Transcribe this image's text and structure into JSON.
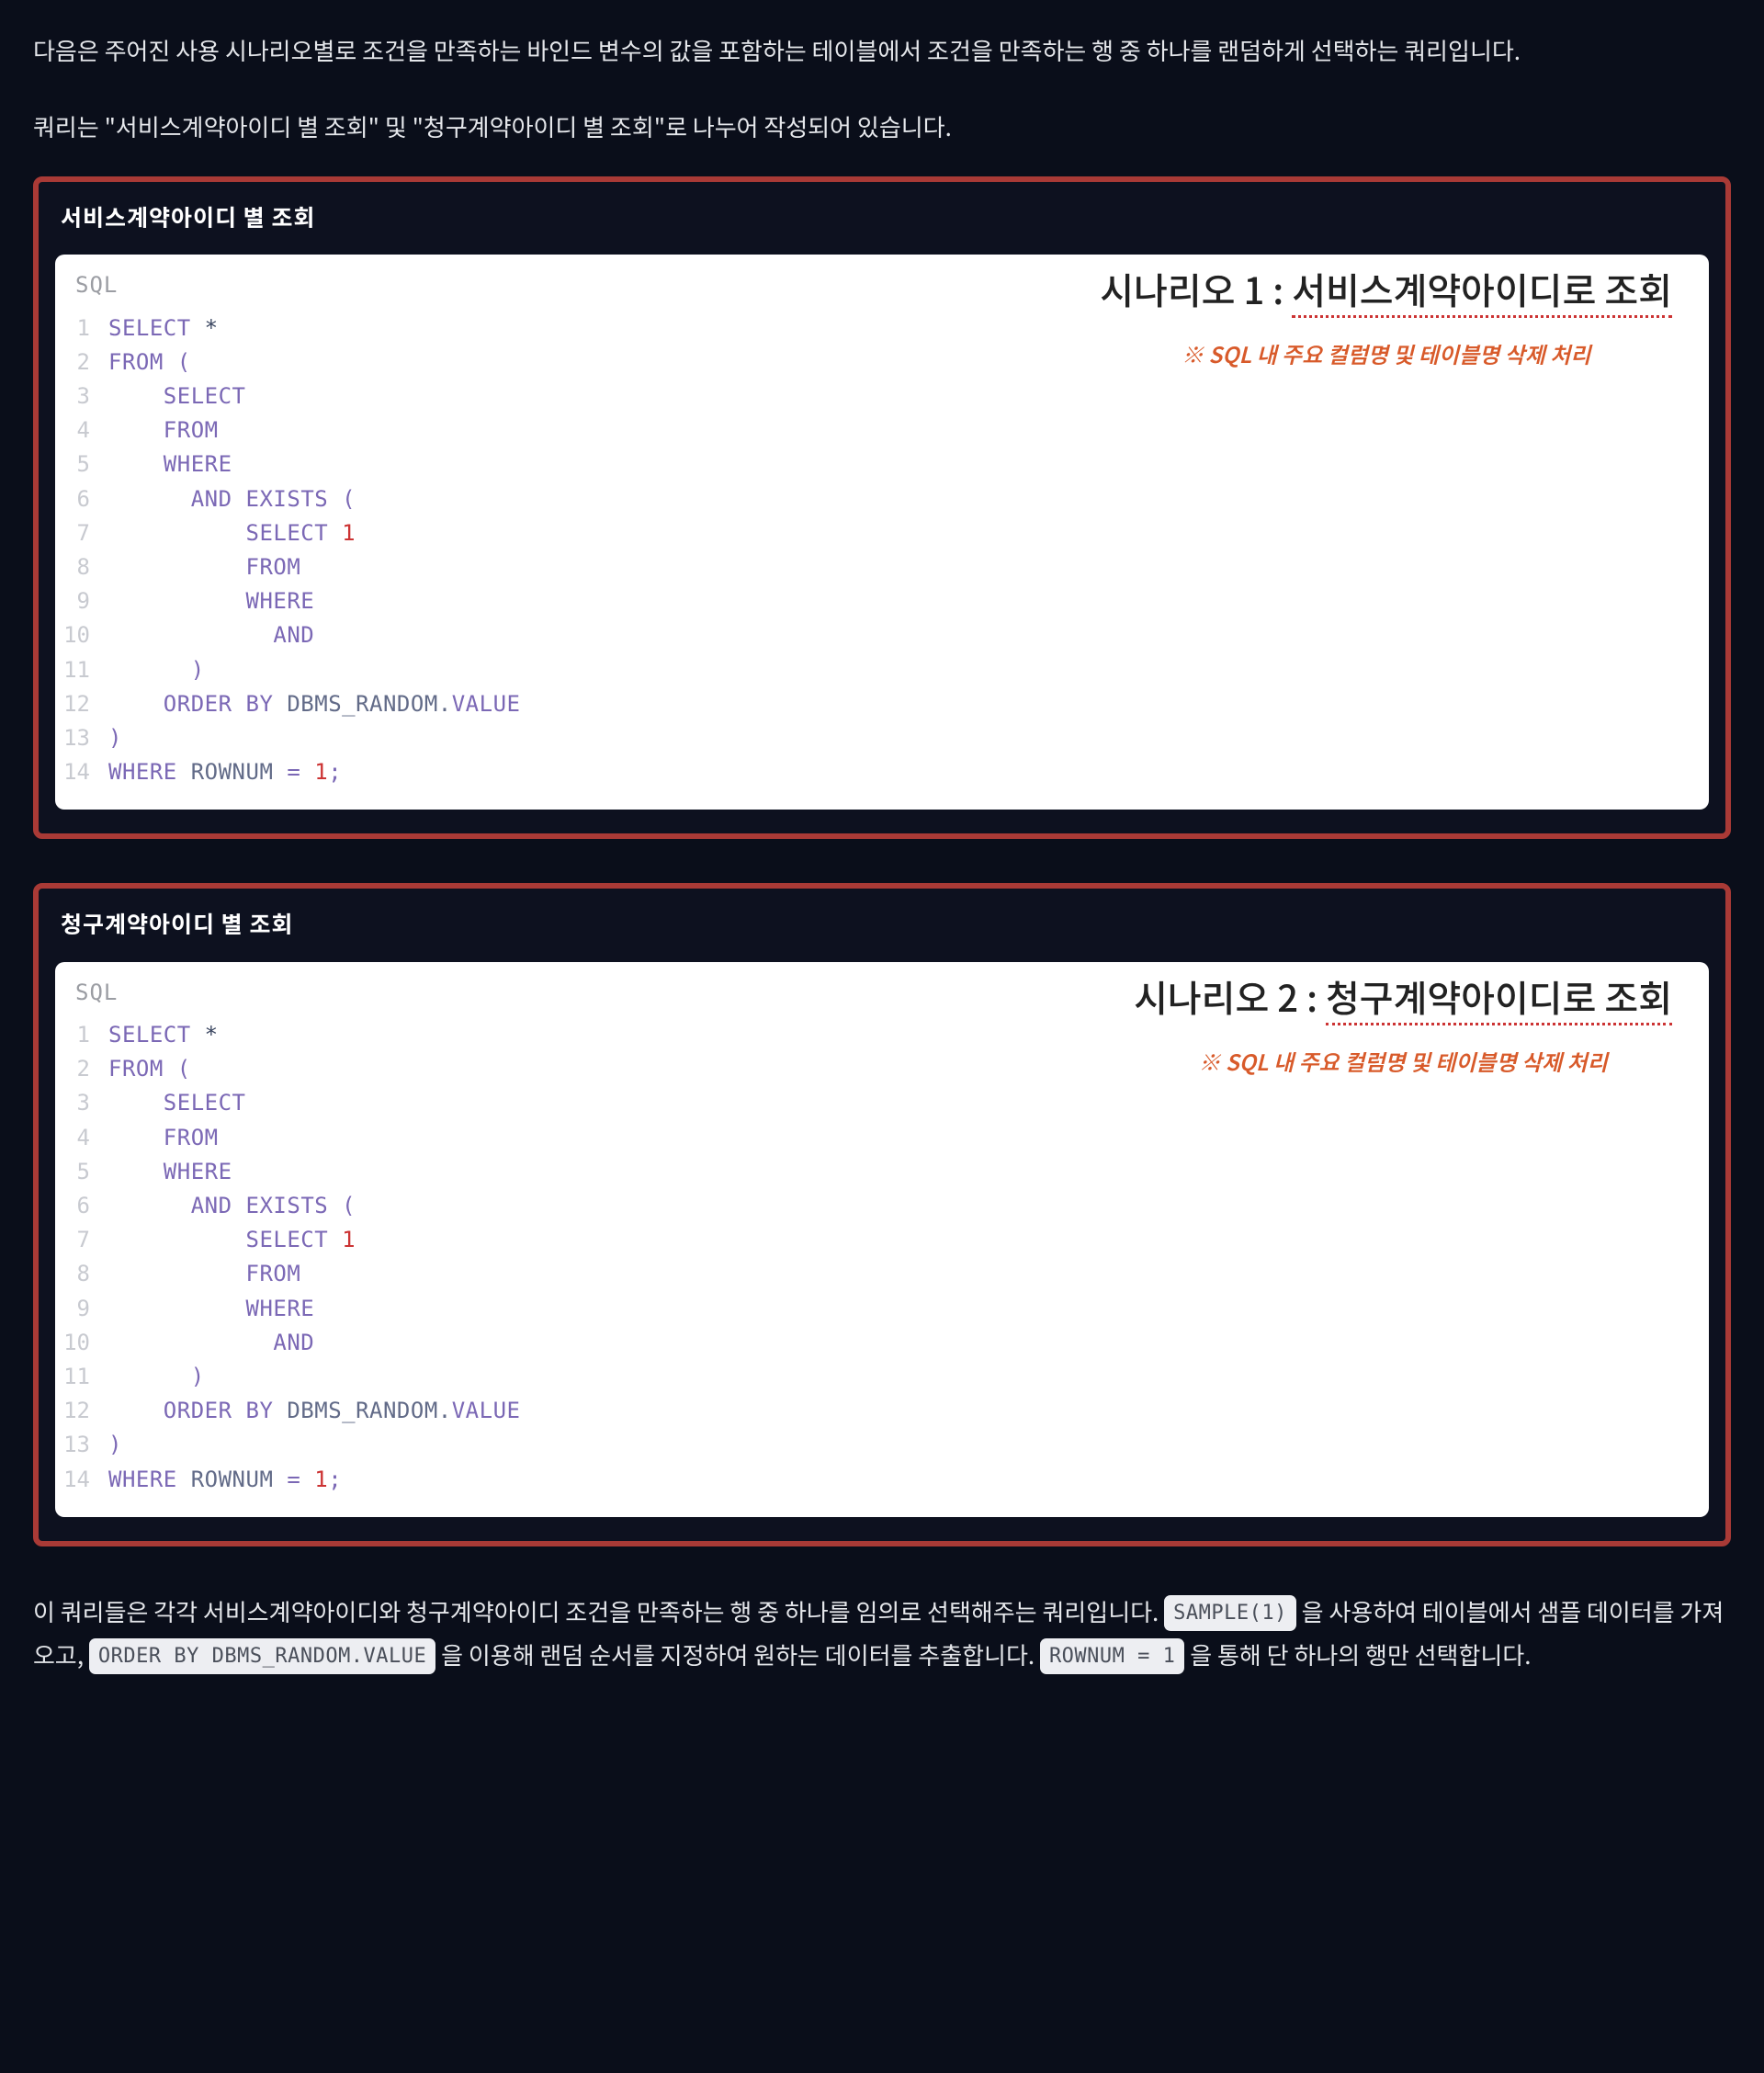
{
  "intro1": "다음은 주어진 사용 시나리오별로 조건을 만족하는 바인드 변수의 값을 포함하는 테이블에서 조건을 만족하는 행 중 하나를 랜덤하게 선택하는 쿼리입니다.",
  "intro2": "쿼리는 \"서비스계약아이디 별 조회\" 및 \"청구계약아이디 별 조회\"로 나누어 작성되어 있습니다.",
  "sections": [
    {
      "title": "서비스계약아이디 별 조회",
      "lang": "SQL",
      "scenario_label_prefix": "시나리오 1 : ",
      "scenario_label_main": "서비스계약아이디로 조회",
      "redaction_note": "※ SQL 내 주요 컬럼명 및 테이블명 삭제 처리",
      "lines": [
        [
          {
            "t": "SELECT",
            "c": "kw"
          },
          {
            "t": " *",
            "c": ""
          }
        ],
        [
          {
            "t": "FROM",
            "c": "kw"
          },
          {
            "t": " (",
            "c": "sym"
          }
        ],
        [
          {
            "t": "    ",
            "c": ""
          },
          {
            "t": "SELECT",
            "c": "kw"
          }
        ],
        [
          {
            "t": "    ",
            "c": ""
          },
          {
            "t": "FROM",
            "c": "kw"
          }
        ],
        [
          {
            "t": "    ",
            "c": ""
          },
          {
            "t": "WHERE",
            "c": "kw"
          }
        ],
        [
          {
            "t": "      ",
            "c": ""
          },
          {
            "t": "AND",
            "c": "kw"
          },
          {
            "t": " ",
            "c": ""
          },
          {
            "t": "EXISTS",
            "c": "kw"
          },
          {
            "t": " (",
            "c": "sym"
          }
        ],
        [
          {
            "t": "          ",
            "c": ""
          },
          {
            "t": "SELECT",
            "c": "kw"
          },
          {
            "t": " ",
            "c": ""
          },
          {
            "t": "1",
            "c": "num"
          }
        ],
        [
          {
            "t": "          ",
            "c": ""
          },
          {
            "t": "FROM",
            "c": "kw"
          }
        ],
        [
          {
            "t": "          ",
            "c": ""
          },
          {
            "t": "WHERE",
            "c": "kw"
          }
        ],
        [
          {
            "t": "            ",
            "c": ""
          },
          {
            "t": "AND",
            "c": "kw"
          }
        ],
        [
          {
            "t": "      ",
            "c": ""
          },
          {
            "t": ")",
            "c": "sym"
          }
        ],
        [
          {
            "t": "    ",
            "c": ""
          },
          {
            "t": "ORDER BY",
            "c": "kw"
          },
          {
            "t": " DBMS_RANDOM.",
            "c": "id"
          },
          {
            "t": "VALUE",
            "c": "kw"
          }
        ],
        [
          {
            "t": ")",
            "c": "sym"
          }
        ],
        [
          {
            "t": "WHERE",
            "c": "kw"
          },
          {
            "t": " ROWNUM ",
            "c": "id"
          },
          {
            "t": "=",
            "c": "sym"
          },
          {
            "t": " ",
            "c": ""
          },
          {
            "t": "1",
            "c": "num"
          },
          {
            "t": ";",
            "c": "sym"
          }
        ]
      ]
    },
    {
      "title": "청구계약아이디 별 조회",
      "lang": "SQL",
      "scenario_label_prefix": "시나리오 2 : ",
      "scenario_label_main": "청구계약아이디로 조회",
      "redaction_note": "※ SQL 내 주요 컬럼명 및 테이블명 삭제 처리",
      "lines": [
        [
          {
            "t": "SELECT",
            "c": "kw"
          },
          {
            "t": " *",
            "c": ""
          }
        ],
        [
          {
            "t": "FROM",
            "c": "kw"
          },
          {
            "t": " (",
            "c": "sym"
          }
        ],
        [
          {
            "t": "    ",
            "c": ""
          },
          {
            "t": "SELECT",
            "c": "kw"
          }
        ],
        [
          {
            "t": "    ",
            "c": ""
          },
          {
            "t": "FROM",
            "c": "kw"
          }
        ],
        [
          {
            "t": "    ",
            "c": ""
          },
          {
            "t": "WHERE",
            "c": "kw"
          }
        ],
        [
          {
            "t": "      ",
            "c": ""
          },
          {
            "t": "AND",
            "c": "kw"
          },
          {
            "t": " ",
            "c": ""
          },
          {
            "t": "EXISTS",
            "c": "kw"
          },
          {
            "t": " (",
            "c": "sym"
          }
        ],
        [
          {
            "t": "          ",
            "c": ""
          },
          {
            "t": "SELECT",
            "c": "kw"
          },
          {
            "t": " ",
            "c": ""
          },
          {
            "t": "1",
            "c": "num"
          }
        ],
        [
          {
            "t": "          ",
            "c": ""
          },
          {
            "t": "FROM",
            "c": "kw"
          }
        ],
        [
          {
            "t": "          ",
            "c": ""
          },
          {
            "t": "WHERE",
            "c": "kw"
          }
        ],
        [
          {
            "t": "            ",
            "c": ""
          },
          {
            "t": "AND",
            "c": "kw"
          }
        ],
        [
          {
            "t": "      ",
            "c": ""
          },
          {
            "t": ")",
            "c": "sym"
          }
        ],
        [
          {
            "t": "    ",
            "c": ""
          },
          {
            "t": "ORDER BY",
            "c": "kw"
          },
          {
            "t": " DBMS_RANDOM.",
            "c": "id"
          },
          {
            "t": "VALUE",
            "c": "kw"
          }
        ],
        [
          {
            "t": ")",
            "c": "sym"
          }
        ],
        [
          {
            "t": "WHERE",
            "c": "kw"
          },
          {
            "t": " ROWNUM ",
            "c": "id"
          },
          {
            "t": "=",
            "c": "sym"
          },
          {
            "t": " ",
            "c": ""
          },
          {
            "t": "1",
            "c": "num"
          },
          {
            "t": ";",
            "c": "sym"
          }
        ]
      ]
    }
  ],
  "footer": {
    "seg1": "이 쿼리들은 각각 서비스계약아이디와 청구계약아이디 조건을 만족하는 행 중 하나를 임의로 선택해주는 쿼리입니다. ",
    "pill1": "SAMPLE(1)",
    "seg2": " 을 사용하여 테이블에서 샘플 데이터를 가져오고, ",
    "pill2": "ORDER BY DBMS_RANDOM.VALUE",
    "seg3": " 을 이용해 랜덤 순서를 지정하여 원하는 데이터를 추출합니다. ",
    "pill3": "ROWNUM = 1",
    "seg4": " 을 통해 단 하나의 행만 선택합니다."
  }
}
